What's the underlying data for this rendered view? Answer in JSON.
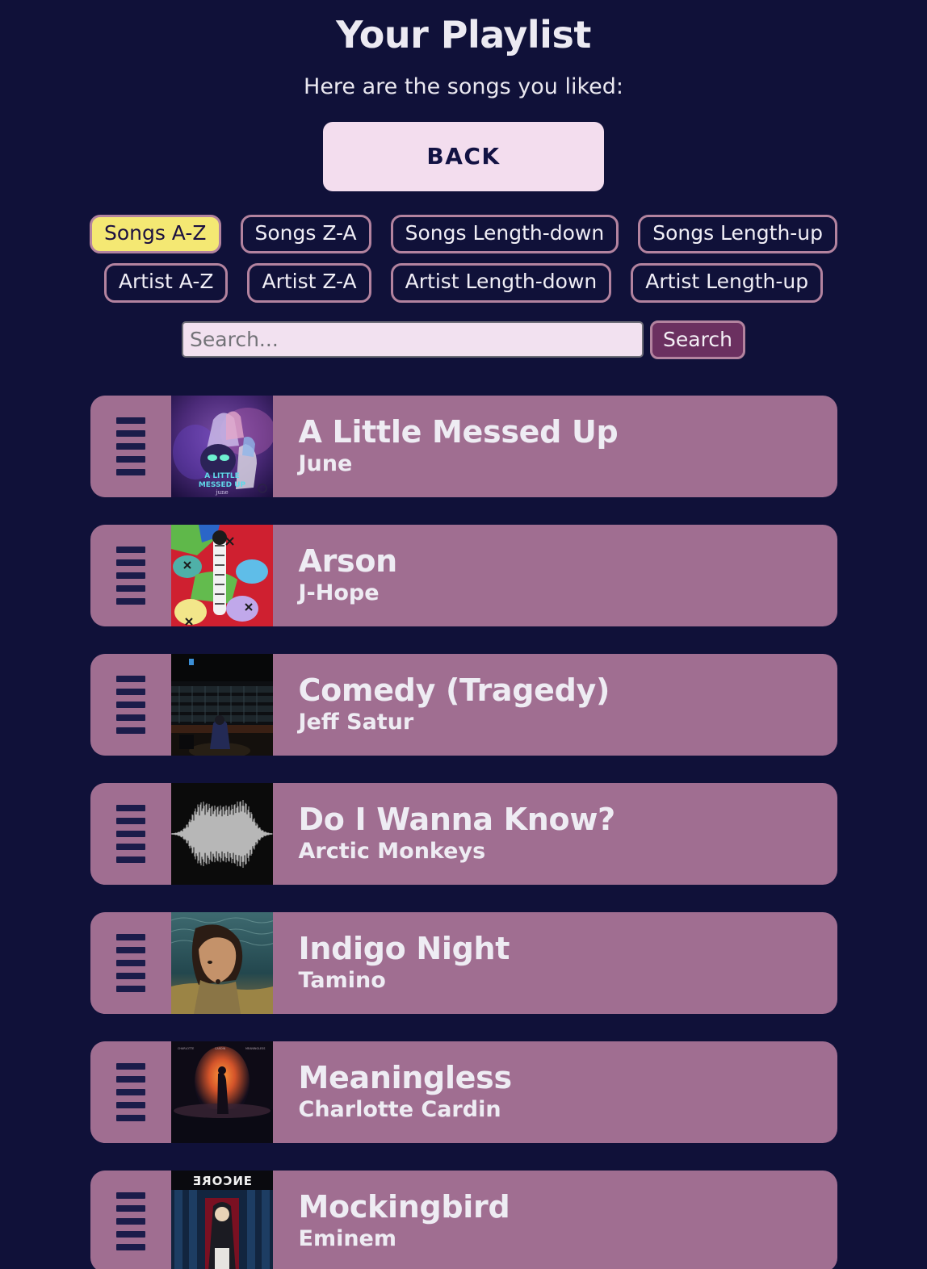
{
  "header": {
    "title": "Your Playlist",
    "subtitle": "Here are the songs you liked:",
    "back_label": "BACK"
  },
  "sort_controls": {
    "row1": [
      {
        "label": "Songs A-Z",
        "active": true
      },
      {
        "label": "Songs Z-A",
        "active": false
      },
      {
        "label": "Songs Length-down",
        "active": false
      },
      {
        "label": "Songs Length-up",
        "active": false
      }
    ],
    "row2": [
      {
        "label": "Artist A-Z",
        "active": false
      },
      {
        "label": "Artist Z-A",
        "active": false
      },
      {
        "label": "Artist Length-down",
        "active": false
      },
      {
        "label": "Artist Length-up",
        "active": false
      }
    ]
  },
  "search": {
    "placeholder": "Search...",
    "value": "",
    "button_label": "Search"
  },
  "songs": [
    {
      "title": "A Little Messed Up",
      "artist": "June",
      "art": "a-little-messed-up-cover",
      "art_caption": "A LITTLE MESSED UP"
    },
    {
      "title": "Arson",
      "artist": "J-Hope",
      "art": "arson-cover",
      "art_caption": ""
    },
    {
      "title": "Comedy (Tragedy)",
      "artist": "Jeff Satur",
      "art": "comedy-tragedy-cover",
      "art_caption": ""
    },
    {
      "title": "Do I Wanna Know?",
      "artist": "Arctic Monkeys",
      "art": "am-waveform-cover",
      "art_caption": ""
    },
    {
      "title": "Indigo Night",
      "artist": "Tamino",
      "art": "indigo-night-cover",
      "art_caption": ""
    },
    {
      "title": "Meaningless",
      "artist": "Charlotte Cardin",
      "art": "meaningless-cover",
      "art_caption": ""
    },
    {
      "title": "Mockingbird",
      "artist": "Eminem",
      "art": "encore-cover",
      "art_caption": "ENCORE"
    }
  ],
  "colors": {
    "background": "#101139",
    "card": "#a06e91",
    "accent_border": "#b3839f",
    "active_button": "#f4e873",
    "search_button": "#6b3060",
    "input_background": "#f2e1f0",
    "back_button": "#f3ddee",
    "text_light": "#eeecf3",
    "handle": "#1b1c4a"
  },
  "icons": {
    "drag_handle": "drag-handle-icon"
  }
}
